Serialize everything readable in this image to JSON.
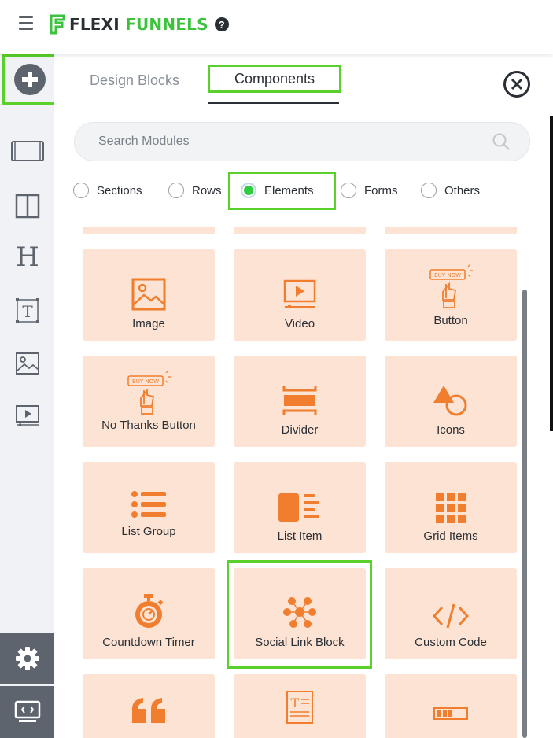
{
  "app": {
    "logo_text_left": "FLEXI",
    "logo_text_right": "FUNNELS",
    "help": "?"
  },
  "tabs": {
    "design_blocks": "Design Blocks",
    "components": "Components"
  },
  "search": {
    "placeholder": "Search Modules"
  },
  "filters": [
    {
      "label": "Sections",
      "selected": false
    },
    {
      "label": "Rows",
      "selected": false
    },
    {
      "label": "Elements",
      "selected": true
    },
    {
      "label": "Forms",
      "selected": false
    },
    {
      "label": "Others",
      "selected": false
    }
  ],
  "cards": {
    "image": "Image",
    "video": "Video",
    "button": "Button",
    "no_thanks": "No Thanks Button",
    "divider": "Divider",
    "icons": "Icons",
    "list_group": "List Group",
    "list_item": "List Item",
    "grid_items": "Grid Items",
    "countdown": "Countdown Timer",
    "social": "Social Link Block",
    "custom_code": "Custom Code",
    "buy_now": "BUY NOW"
  },
  "colors": {
    "accent": "#F07E2E",
    "card_bg": "#FDE3D3",
    "highlight": "#59D12A",
    "logo_green": "#3CC23C",
    "sidebar_bg": "#F0F2F5"
  }
}
